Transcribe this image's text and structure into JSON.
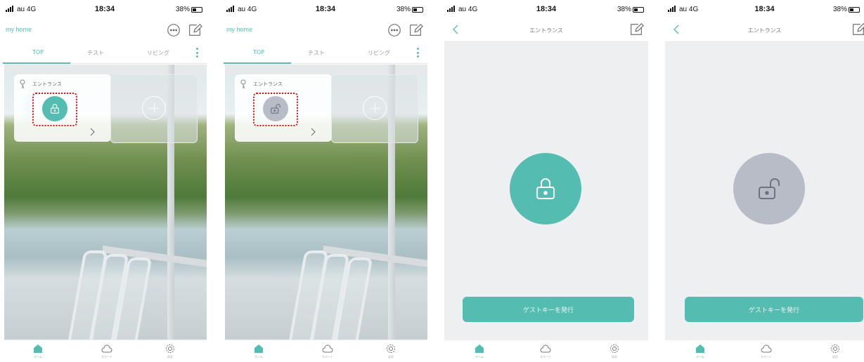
{
  "status_bar": {
    "carrier": "au 4G",
    "time": "18:34",
    "battery": "38%"
  },
  "home": {
    "title": "my home",
    "tabs": [
      {
        "label": "TOP",
        "active": true
      },
      {
        "label": "テスト"
      },
      {
        "label": "リビング"
      }
    ],
    "lock_card_name": "エントランス"
  },
  "detail": {
    "title": "エントランス",
    "guest_key_button": "ゲストキーを発行"
  },
  "nav": {
    "items": [
      {
        "label": "ホーム",
        "icon": "home-icon"
      },
      {
        "label": "スマート",
        "icon": "cloud-icon"
      },
      {
        "label": "設定",
        "icon": "gear-icon"
      }
    ]
  },
  "screens": [
    {
      "type": "home",
      "lock_state": "locked"
    },
    {
      "type": "home",
      "lock_state": "unlocked"
    },
    {
      "type": "detail",
      "lock_state": "locked"
    },
    {
      "type": "detail",
      "lock_state": "unlocked"
    }
  ],
  "colors": {
    "accent": "#55bcb2",
    "locked": "#55bcb2",
    "unlocked": "#b8bcc6",
    "annotation": "#dd1111"
  }
}
